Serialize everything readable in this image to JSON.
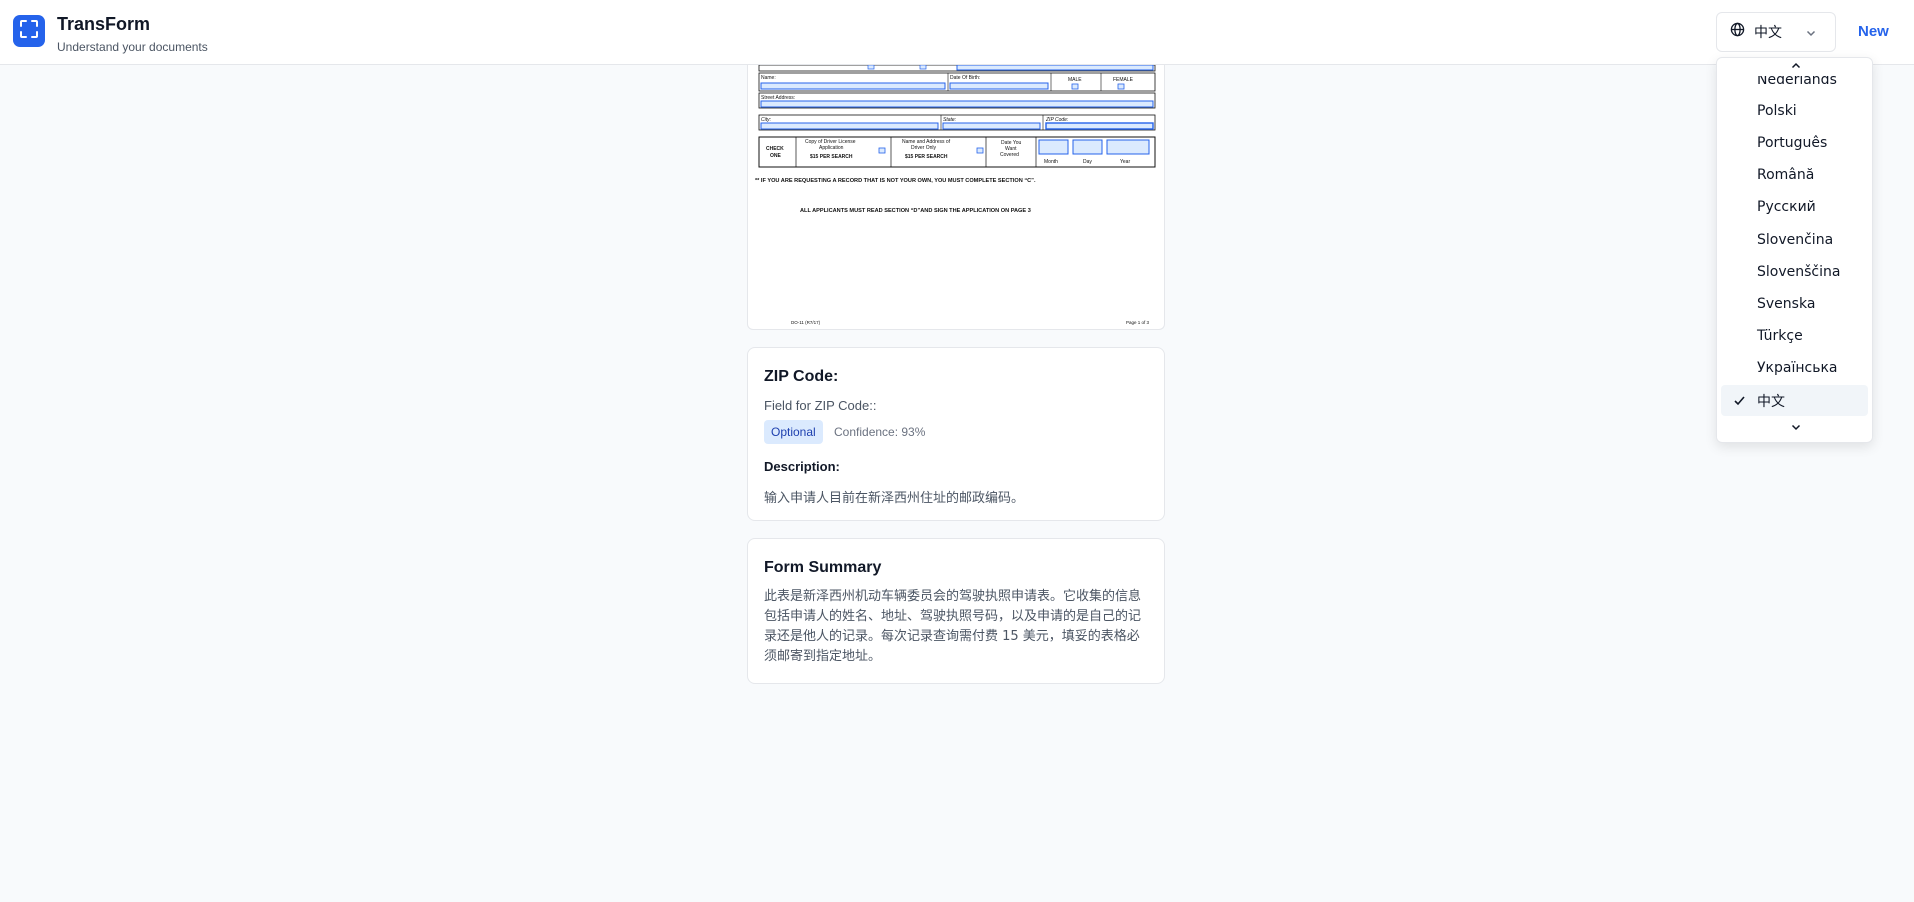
{
  "header": {
    "app_title": "TransForm",
    "app_subtitle": "Understand your documents",
    "language_selected": "中文",
    "new_label": "New"
  },
  "document": {
    "labels": {
      "name": "Name:",
      "dob": "Date Of Birth:",
      "male": "MALE",
      "female": "FEMALE",
      "street": "Street Address:",
      "city": "City:",
      "state": "State:",
      "zip": "ZIP Code:",
      "check_one": "CHECK ONE",
      "copy_app_1": "Copy of Driver License",
      "copy_app_2": "Application",
      "copy_app_3": "$15 PER SEARCH",
      "name_addr_1": "Name and Address of",
      "name_addr_2": "Driver Only",
      "name_addr_3": "$15 PER SEARCH",
      "date_want_1": "Date You",
      "date_want_2": "Want",
      "date_want_3": "Covered",
      "month": "Month",
      "day": "Day",
      "year": "Year",
      "notice_1": "** IF YOU ARE REQUESTING A RECORD THAT IS NOT YOUR OWN, YOU MUST COMPLETE SECTION “C”.",
      "notice_2": "ALL APPLICANTS MUST READ SECTION “D”AND SIGN THE APPLICATION ON PAGE 3",
      "footer_left": "DO-11 (R7/17)",
      "footer_right": "Page 1 of 3"
    }
  },
  "field": {
    "title": "ZIP Code:",
    "label": "Field for ZIP Code::",
    "badge": "Optional",
    "confidence": "Confidence: 93%",
    "description_heading": "Description:",
    "description": "输入申请人目前在新泽西州住址的邮政编码。"
  },
  "summary": {
    "title": "Form Summary",
    "text": "此表是新泽西州机动车辆委员会的驾驶执照申请表。它收集的信息包括申请人的姓名、地址、驾驶执照号码，以及申请的是自己的记录还是他人的记录。每次记录查询需付费 15 美元，填妥的表格必须邮寄到指定地址。"
  },
  "dropdown": {
    "partial_top": "Nederlands",
    "options": [
      "Polski",
      "Português",
      "Română",
      "Русский",
      "Slovenčina",
      "Slovenščina",
      "Svenska",
      "Türkçe",
      "Українська",
      "中文"
    ],
    "selected": "中文"
  },
  "colors": {
    "accent": "#2563eb",
    "badge_bg": "#dbeafe",
    "badge_text": "#1e40af",
    "form_field": "#dbeafe",
    "form_field_border": "#2563eb"
  }
}
